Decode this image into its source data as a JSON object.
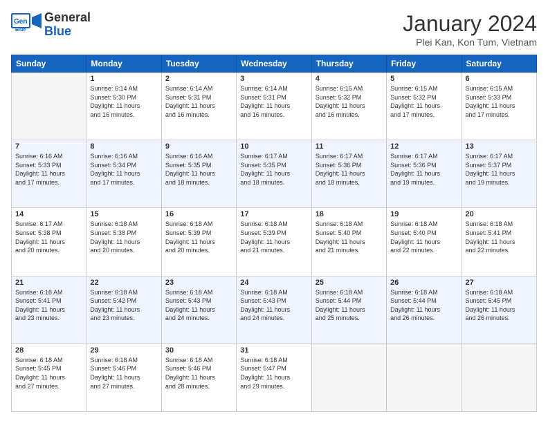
{
  "header": {
    "logo_general": "General",
    "logo_blue": "Blue",
    "month_year": "January 2024",
    "location": "Plei Kan, Kon Tum, Vietnam"
  },
  "days_of_week": [
    "Sunday",
    "Monday",
    "Tuesday",
    "Wednesday",
    "Thursday",
    "Friday",
    "Saturday"
  ],
  "weeks": [
    [
      {
        "day": "",
        "info": ""
      },
      {
        "day": "1",
        "info": "Sunrise: 6:14 AM\nSunset: 5:30 PM\nDaylight: 11 hours\nand 16 minutes."
      },
      {
        "day": "2",
        "info": "Sunrise: 6:14 AM\nSunset: 5:31 PM\nDaylight: 11 hours\nand 16 minutes."
      },
      {
        "day": "3",
        "info": "Sunrise: 6:14 AM\nSunset: 5:31 PM\nDaylight: 11 hours\nand 16 minutes."
      },
      {
        "day": "4",
        "info": "Sunrise: 6:15 AM\nSunset: 5:32 PM\nDaylight: 11 hours\nand 16 minutes."
      },
      {
        "day": "5",
        "info": "Sunrise: 6:15 AM\nSunset: 5:32 PM\nDaylight: 11 hours\nand 17 minutes."
      },
      {
        "day": "6",
        "info": "Sunrise: 6:15 AM\nSunset: 5:33 PM\nDaylight: 11 hours\nand 17 minutes."
      }
    ],
    [
      {
        "day": "7",
        "info": "Sunrise: 6:16 AM\nSunset: 5:33 PM\nDaylight: 11 hours\nand 17 minutes."
      },
      {
        "day": "8",
        "info": "Sunrise: 6:16 AM\nSunset: 5:34 PM\nDaylight: 11 hours\nand 17 minutes."
      },
      {
        "day": "9",
        "info": "Sunrise: 6:16 AM\nSunset: 5:35 PM\nDaylight: 11 hours\nand 18 minutes."
      },
      {
        "day": "10",
        "info": "Sunrise: 6:17 AM\nSunset: 5:35 PM\nDaylight: 11 hours\nand 18 minutes."
      },
      {
        "day": "11",
        "info": "Sunrise: 6:17 AM\nSunset: 5:36 PM\nDaylight: 11 hours\nand 18 minutes."
      },
      {
        "day": "12",
        "info": "Sunrise: 6:17 AM\nSunset: 5:36 PM\nDaylight: 11 hours\nand 19 minutes."
      },
      {
        "day": "13",
        "info": "Sunrise: 6:17 AM\nSunset: 5:37 PM\nDaylight: 11 hours\nand 19 minutes."
      }
    ],
    [
      {
        "day": "14",
        "info": "Sunrise: 6:17 AM\nSunset: 5:38 PM\nDaylight: 11 hours\nand 20 minutes."
      },
      {
        "day": "15",
        "info": "Sunrise: 6:18 AM\nSunset: 5:38 PM\nDaylight: 11 hours\nand 20 minutes."
      },
      {
        "day": "16",
        "info": "Sunrise: 6:18 AM\nSunset: 5:39 PM\nDaylight: 11 hours\nand 20 minutes."
      },
      {
        "day": "17",
        "info": "Sunrise: 6:18 AM\nSunset: 5:39 PM\nDaylight: 11 hours\nand 21 minutes."
      },
      {
        "day": "18",
        "info": "Sunrise: 6:18 AM\nSunset: 5:40 PM\nDaylight: 11 hours\nand 21 minutes."
      },
      {
        "day": "19",
        "info": "Sunrise: 6:18 AM\nSunset: 5:40 PM\nDaylight: 11 hours\nand 22 minutes."
      },
      {
        "day": "20",
        "info": "Sunrise: 6:18 AM\nSunset: 5:41 PM\nDaylight: 11 hours\nand 22 minutes."
      }
    ],
    [
      {
        "day": "21",
        "info": "Sunrise: 6:18 AM\nSunset: 5:41 PM\nDaylight: 11 hours\nand 23 minutes."
      },
      {
        "day": "22",
        "info": "Sunrise: 6:18 AM\nSunset: 5:42 PM\nDaylight: 11 hours\nand 23 minutes."
      },
      {
        "day": "23",
        "info": "Sunrise: 6:18 AM\nSunset: 5:43 PM\nDaylight: 11 hours\nand 24 minutes."
      },
      {
        "day": "24",
        "info": "Sunrise: 6:18 AM\nSunset: 5:43 PM\nDaylight: 11 hours\nand 24 minutes."
      },
      {
        "day": "25",
        "info": "Sunrise: 6:18 AM\nSunset: 5:44 PM\nDaylight: 11 hours\nand 25 minutes."
      },
      {
        "day": "26",
        "info": "Sunrise: 6:18 AM\nSunset: 5:44 PM\nDaylight: 11 hours\nand 26 minutes."
      },
      {
        "day": "27",
        "info": "Sunrise: 6:18 AM\nSunset: 5:45 PM\nDaylight: 11 hours\nand 26 minutes."
      }
    ],
    [
      {
        "day": "28",
        "info": "Sunrise: 6:18 AM\nSunset: 5:45 PM\nDaylight: 11 hours\nand 27 minutes."
      },
      {
        "day": "29",
        "info": "Sunrise: 6:18 AM\nSunset: 5:46 PM\nDaylight: 11 hours\nand 27 minutes."
      },
      {
        "day": "30",
        "info": "Sunrise: 6:18 AM\nSunset: 5:46 PM\nDaylight: 11 hours\nand 28 minutes."
      },
      {
        "day": "31",
        "info": "Sunrise: 6:18 AM\nSunset: 5:47 PM\nDaylight: 11 hours\nand 29 minutes."
      },
      {
        "day": "",
        "info": ""
      },
      {
        "day": "",
        "info": ""
      },
      {
        "day": "",
        "info": ""
      }
    ]
  ]
}
